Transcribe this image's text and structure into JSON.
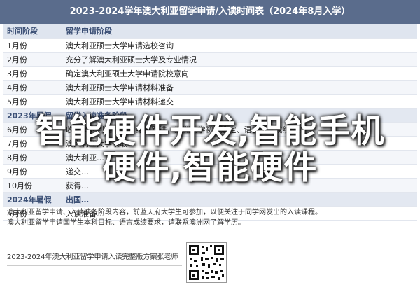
{
  "banner": {
    "title": "2023-2024学年澳大利亚留学申请/入读时间表（2024年8月入学）"
  },
  "table": {
    "header": {
      "col1": "时间阶段",
      "col2": "留学申请阶段"
    },
    "rows": [
      {
        "type": "row",
        "c1": "1月份",
        "c2": "澳大利亚硕士大学申请选校咨询"
      },
      {
        "type": "row",
        "c1": "2月份",
        "c2": "充分了解澳大利亚硕士大学及专业情况"
      },
      {
        "type": "row",
        "c1": "3月份",
        "c2": "确定澳大利亚硕士大学申请院校意向"
      },
      {
        "type": "row",
        "c1": "4月份",
        "c2": "澳大利亚硕士大学申请材料准备"
      },
      {
        "type": "row",
        "c1": "5月份",
        "c2": "澳大利亚硕士大学申请材料递交"
      },
      {
        "type": "section",
        "c1": "2023年暑假",
        "c2": "留学入读准备阶段"
      },
      {
        "type": "row",
        "c1": "6月份",
        "c2": "收到澳大利亚 Offer 结果跟进、澳洲大学初步选定、语言考试成绩提交"
      },
      {
        "type": "row",
        "c1": "7月份",
        "c2": "澳大利亚大学录取…"
      },
      {
        "type": "row",
        "c1": "8月份",
        "c2": "澳大利亚…"
      },
      {
        "type": "row",
        "c1": "9月份",
        "c2": "递交…"
      },
      {
        "type": "row",
        "c1": "10月份",
        "c2": "获得…"
      },
      {
        "type": "section",
        "c1": "2024年暑假",
        "c2": "出国…"
      },
      {
        "type": "row",
        "c1": "5月份",
        "c2": "入读准备…"
      }
    ]
  },
  "notes": {
    "line1": "澳大利亚留学申请、入读准备阶段内容，前蓝天府大学生可参加，以便关注于同学网发出的入读课程。",
    "line2": "澳大利亚留学申请国学生本科目标、语言成绩要求，请联系澳洲网了解学历。"
  },
  "footer": {
    "text": "2023-2024年澳大利亚留学申请入读完整版方案张老师"
  },
  "qr": {
    "icon": "qr-code-icon"
  },
  "overlay": {
    "line1": "智能硬件开发,智能手机",
    "line2": "硬件,智能硬件"
  }
}
